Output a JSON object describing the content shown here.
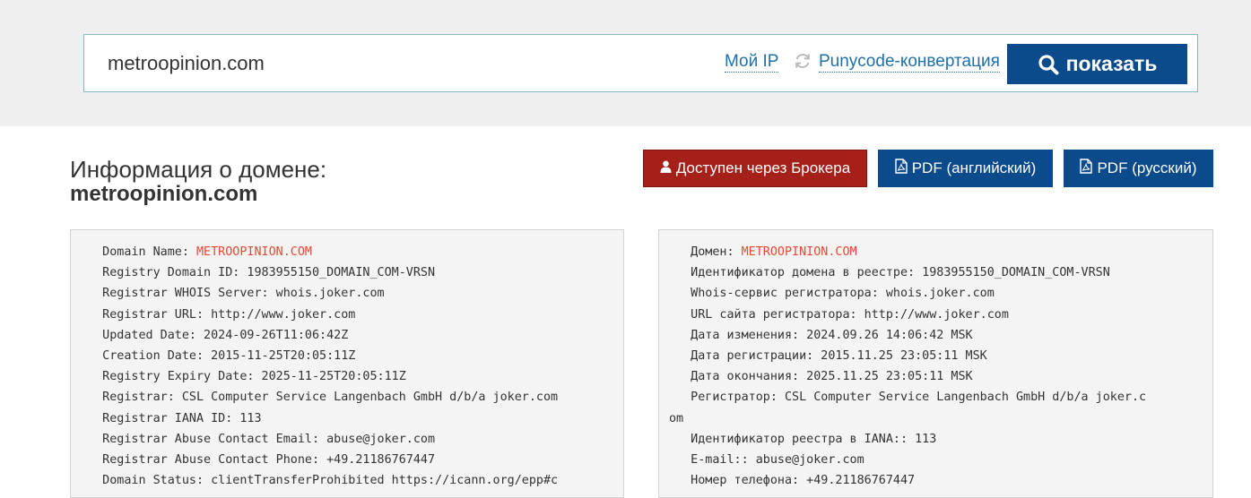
{
  "search": {
    "value": "metroopinion.com",
    "my_ip_label": "Мой IP",
    "punycode_label": "Punycode-конвертация",
    "show_button_label": "показать"
  },
  "header": {
    "title_prefix": "Информация о домене:",
    "title_domain": "metroopinion.com"
  },
  "actions": {
    "broker_label": "Доступен через Брокера",
    "pdf_en_label": "PDF (английский)",
    "pdf_ru_label": "PDF (русский)"
  },
  "whois_en": {
    "domain_label": "   Domain Name: ",
    "domain_value": "METROOPINION.COM",
    "lines": [
      "   Registry Domain ID: 1983955150_DOMAIN_COM-VRSN",
      "   Registrar WHOIS Server: whois.joker.com",
      "   Registrar URL: http://www.joker.com",
      "   Updated Date: 2024-09-26T11:06:42Z",
      "   Creation Date: 2015-11-25T20:05:11Z",
      "   Registry Expiry Date: 2025-11-25T20:05:11Z",
      "   Registrar: CSL Computer Service Langenbach GmbH d/b/a joker.com",
      "   Registrar IANA ID: 113",
      "   Registrar Abuse Contact Email: abuse@joker.com",
      "   Registrar Abuse Contact Phone: +49.21186767447",
      "   Domain Status: clientTransferProhibited https://icann.org/epp#c"
    ]
  },
  "whois_ru": {
    "domain_label": "   Домен: ",
    "domain_value": "METROOPINION.COM",
    "lines": [
      "   Идентификатор домена в реестре: 1983955150_DOMAIN_COM-VRSN",
      "   Whois-сервис регистратора: whois.joker.com",
      "   URL сайта регистратора: http://www.joker.com",
      "   Дата изменения: 2024.09.26 14:06:42 MSK",
      "   Дата регистрации: 2015.11.25 23:05:11 MSK",
      "   Дата окончания: 2025.11.25 23:05:11 MSK",
      "   Регистратор: CSL Computer Service Langenbach GmbH d/b/a joker.c",
      "om",
      "   Идентификатор реестра в IANA:: 113",
      "   E-mail:: abuse@joker.com",
      "   Номер телефона: +49.21186767447"
    ]
  },
  "colors": {
    "primary": "#0b4a8b",
    "danger": "#a52019",
    "link": "#1f6fa8",
    "domain_highlight": "#e84a2f"
  }
}
